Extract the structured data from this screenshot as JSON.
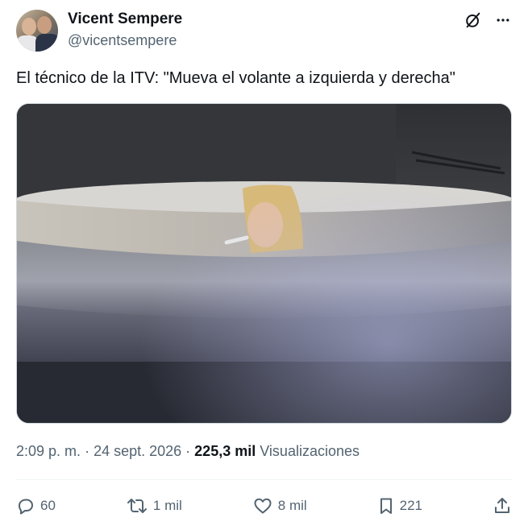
{
  "author": {
    "display_name": "Vicent Sempere",
    "handle": "@vicentsempere",
    "avatar_icon": "avatar-photo"
  },
  "header_icons": [
    "grok-icon",
    "more-icon"
  ],
  "tweet": {
    "text": "El técnico de la ITV: \"Mueva el volante a izquierda y derecha\""
  },
  "media": {
    "kind": "video-still",
    "description_icon": "media-image"
  },
  "meta": {
    "time": "2:09 p. m.",
    "separator": "·",
    "date": "24 sept. 2026",
    "views_count": "225,3 mil",
    "views_label": "Visualizaciones"
  },
  "actions": {
    "replies": "60",
    "reposts": "1 mil",
    "likes": "8 mil",
    "bookmarks": "221"
  },
  "colors": {
    "text_primary": "#0f1419",
    "text_secondary": "#536471",
    "divider": "#eff3f4",
    "media_border": "#cfd9de"
  }
}
